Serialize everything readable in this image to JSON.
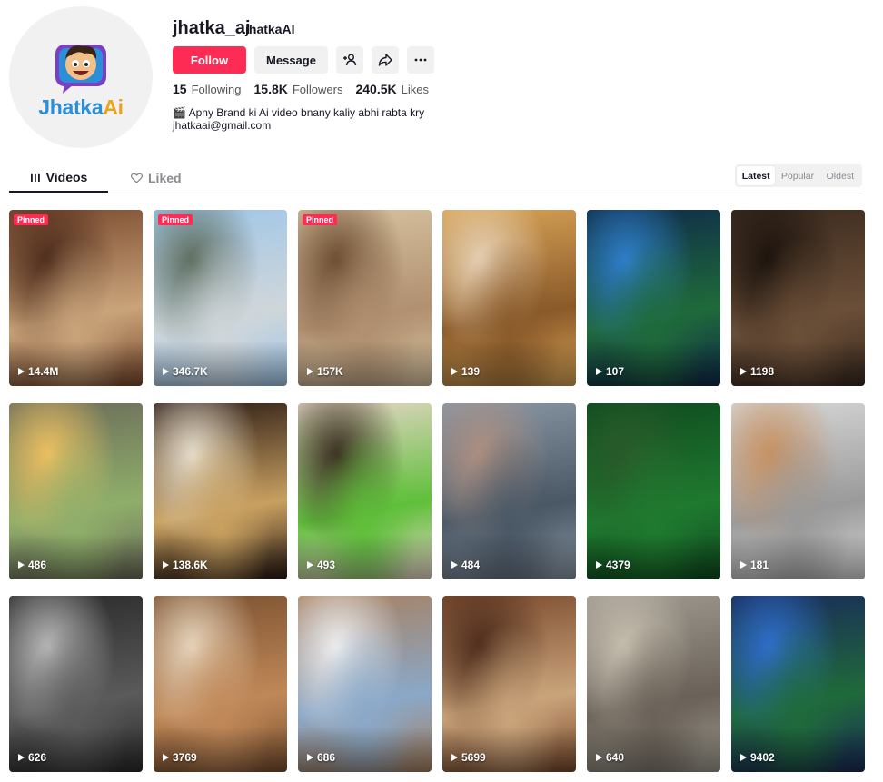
{
  "profile": {
    "logo_text_1": "Jhatka",
    "logo_text_2": "Ai",
    "username": "jhatka_ai",
    "nickname": "jhatkaAI",
    "follow_label": "Follow",
    "message_label": "Message",
    "stats": {
      "following_count": "15",
      "following_label": "Following",
      "followers_count": "15.8K",
      "followers_label": "Followers",
      "likes_count": "240.5K",
      "likes_label": "Likes"
    },
    "bio_line1": "🎬 Apny Brand ki Ai video bnany kaliy abhi rabta kry",
    "bio_line2": "jhatkaai@gmail.com"
  },
  "tabs": {
    "videos_label": "Videos",
    "liked_label": "Liked"
  },
  "sort": {
    "latest": "Latest",
    "popular": "Popular",
    "oldest": "Oldest"
  },
  "pinned_label": "Pinned",
  "videos": [
    {
      "views": "14.4M",
      "pinned": true,
      "colors": [
        "#7a4a2e",
        "#c9a37a",
        "#4a2a1a"
      ]
    },
    {
      "views": "346.7K",
      "pinned": true,
      "colors": [
        "#9fc6e8",
        "#cfd6da",
        "#5a6a5a"
      ]
    },
    {
      "views": "157K",
      "pinned": true,
      "colors": [
        "#d8c3a0",
        "#b09070",
        "#6b4a30"
      ]
    },
    {
      "views": "139",
      "pinned": false,
      "colors": [
        "#d9a456",
        "#8a5a2a",
        "#e7d3b8"
      ]
    },
    {
      "views": "107",
      "pinned": false,
      "colors": [
        "#0f2a4a",
        "#1f6a3a",
        "#2f7fd0"
      ]
    },
    {
      "views": "1198",
      "pinned": false,
      "colors": [
        "#3a2a1f",
        "#6b4f38",
        "#1a120c"
      ]
    },
    {
      "views": "486",
      "pinned": false,
      "colors": [
        "#6b6b5a",
        "#8fae6a",
        "#f0c060"
      ]
    },
    {
      "views": "138.6K",
      "pinned": false,
      "colors": [
        "#2a1a14",
        "#c8a060",
        "#e8e0d0"
      ]
    },
    {
      "views": "493",
      "pinned": false,
      "colors": [
        "#e7d6c8",
        "#5fbf3a",
        "#3a2a20"
      ]
    },
    {
      "views": "484",
      "pinned": false,
      "colors": [
        "#8a98a6",
        "#4a5866",
        "#b09080"
      ]
    },
    {
      "views": "4379",
      "pinned": false,
      "colors": [
        "#0f4a1f",
        "#1f7a2f",
        "#2a5a2a"
      ]
    },
    {
      "views": "181",
      "pinned": false,
      "colors": [
        "#d8d8d8",
        "#9a9a9a",
        "#c89060"
      ]
    },
    {
      "views": "626",
      "pinned": false,
      "colors": [
        "#2a2a2a",
        "#5a5a5a",
        "#bababa"
      ]
    },
    {
      "views": "3769",
      "pinned": false,
      "colors": [
        "#7a5030",
        "#c08858",
        "#e8d8c0"
      ]
    },
    {
      "views": "686",
      "pinned": false,
      "colors": [
        "#a88060",
        "#8aa8c8",
        "#f0f0f0"
      ]
    },
    {
      "views": "5699",
      "pinned": false,
      "colors": [
        "#7a4a2e",
        "#c9a37a",
        "#4a2a1a"
      ]
    },
    {
      "views": "640",
      "pinned": false,
      "colors": [
        "#a09a90",
        "#6a6258",
        "#c8c0b0"
      ]
    },
    {
      "views": "9402",
      "pinned": false,
      "colors": [
        "#1a2a5a",
        "#1f6a3a",
        "#2f6fd0"
      ]
    }
  ]
}
